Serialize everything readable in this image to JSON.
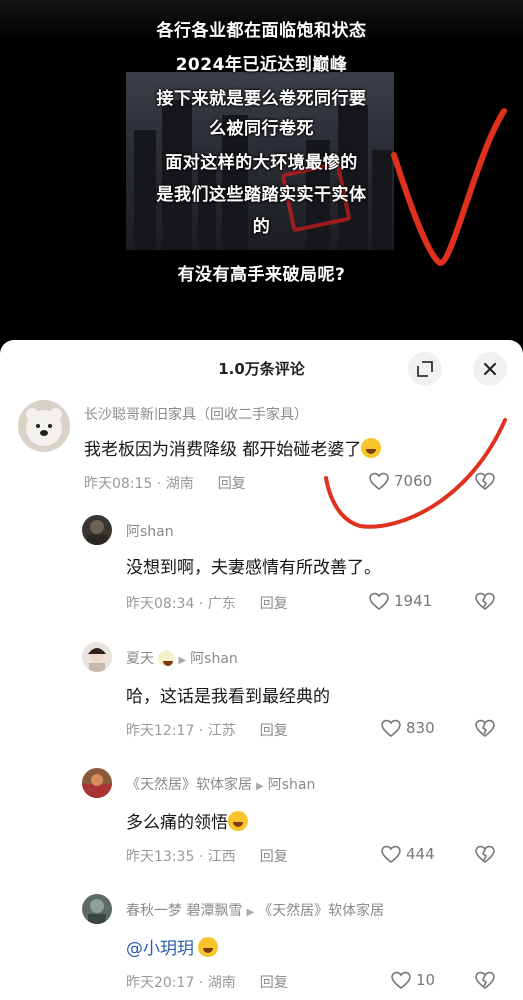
{
  "video": {
    "lines": [
      "各行各业都在面临饱和状态",
      "2024年已近达到巅峰",
      "接下来就是要么卷死同行要",
      "么被同行卷死",
      "面对这样的大环境最惨的",
      "是我们这些踏踏实实干实体",
      "的",
      "有没有高手来破局呢?"
    ]
  },
  "sheet": {
    "title": "1.0万条评论",
    "expand_icon": "expand-icon",
    "close_icon": "close-icon"
  },
  "comments": [
    {
      "user": "长沙聪哥新旧家具（回收二手家具）",
      "text": "我老板因为消费降级 都开始碰老婆了",
      "emoji": "laughing-tears-emoji",
      "time": "昨天08:15 · 湖南",
      "reply_label": "回复",
      "likes": "7060"
    },
    {
      "user": "阿shan",
      "text": "没想到啊，夫妻感情有所改善了。",
      "time": "昨天08:34 · 广东",
      "reply_label": "回复",
      "likes": "1941"
    },
    {
      "user": "夏天",
      "reply_to": "阿shan",
      "text": "哈，这话是我看到最经典的",
      "time": "昨天12:17 · 江苏",
      "reply_label": "回复",
      "likes": "830"
    },
    {
      "user": "《天然居》软体家居",
      "reply_to": "阿shan",
      "text": "多么痛的领悟",
      "emoji": "smirk-emoji",
      "time": "昨天13:35 · 江西",
      "reply_label": "回复",
      "likes": "444"
    },
    {
      "user": "春秋一梦 碧潭飘雪",
      "reply_to": "《天然居》软体家居",
      "text": "@小玥玥",
      "emoji": "laughing-tears-emoji",
      "time": "昨天20:17 · 湖南",
      "reply_label": "回复",
      "likes": "10"
    }
  ],
  "colors": {
    "annotation_red": "#e0301e",
    "mention_blue": "#2b5dad"
  }
}
